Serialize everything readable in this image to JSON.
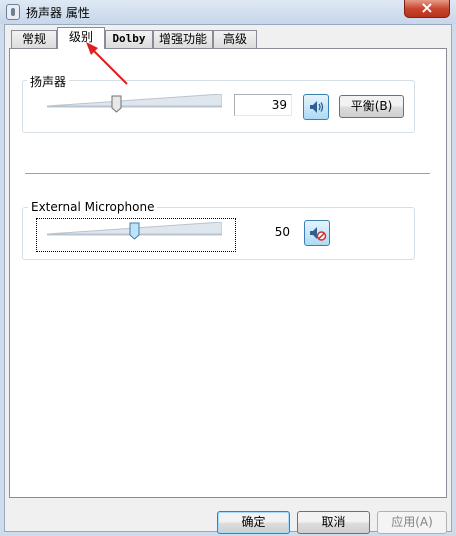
{
  "window": {
    "title": "扬声器 属性"
  },
  "tabs": [
    {
      "label": "常规",
      "active": false
    },
    {
      "label": "级别",
      "active": true
    },
    {
      "label": "Dolby",
      "active": false
    },
    {
      "label": "增强功能",
      "active": false
    },
    {
      "label": "高级",
      "active": false
    }
  ],
  "speaker": {
    "label": "扬声器",
    "level": 39,
    "level_text": "39",
    "mute_icon": "speaker-volume-icon",
    "balance_label": "平衡(B)"
  },
  "microphone": {
    "label": "External Microphone",
    "level": 50,
    "level_text": "50",
    "mute_icon": "speaker-muted-icon"
  },
  "footer": {
    "ok_label": "确定",
    "cancel_label": "取消",
    "apply_label": "应用(A)"
  },
  "colors": {
    "annotation_arrow": "#e02020",
    "selected_button_border": "#3c7fb1"
  }
}
